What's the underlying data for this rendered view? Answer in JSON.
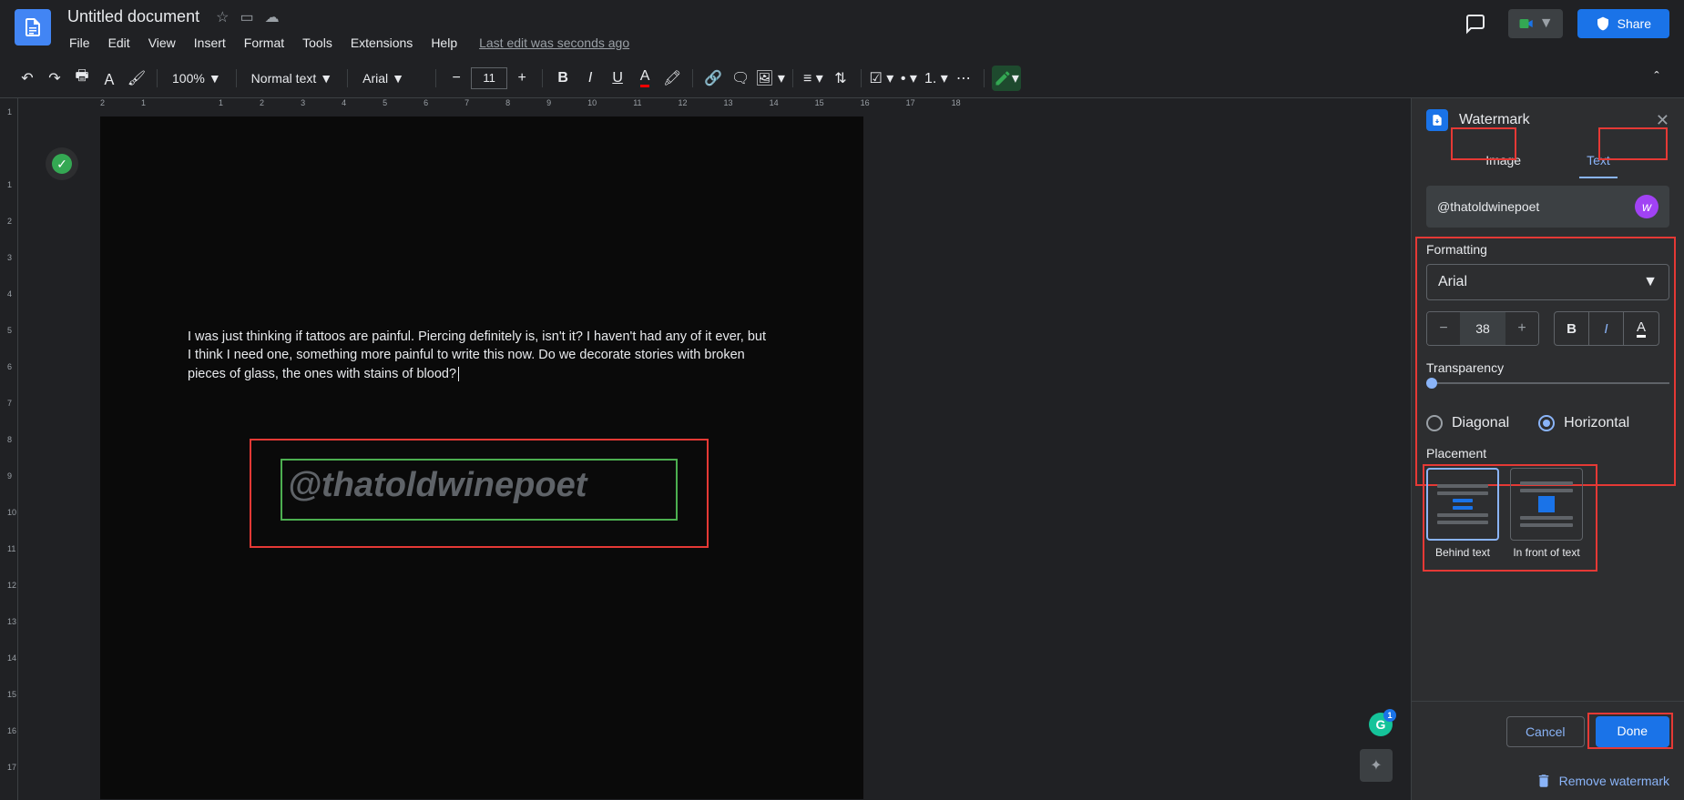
{
  "header": {
    "doc_title": "Untitled document",
    "last_edit": "Last edit was seconds ago",
    "share": "Share"
  },
  "menu": {
    "file": "File",
    "edit": "Edit",
    "view": "View",
    "insert": "Insert",
    "format": "Format",
    "tools": "Tools",
    "extensions": "Extensions",
    "help": "Help"
  },
  "toolbar": {
    "zoom": "100%",
    "style": "Normal text",
    "font": "Arial",
    "font_size": "11"
  },
  "ruler_h": [
    "2",
    "1",
    "",
    "1",
    "2",
    "3",
    "4",
    "5",
    "6",
    "7",
    "8",
    "9",
    "10",
    "11",
    "12",
    "13",
    "14",
    "15",
    "16",
    "17",
    "18"
  ],
  "ruler_v": [
    "1",
    "",
    "1",
    "2",
    "3",
    "4",
    "5",
    "6",
    "7",
    "8",
    "9",
    "10",
    "11",
    "12",
    "13",
    "14",
    "15",
    "16",
    "17"
  ],
  "document": {
    "body_text": "I was just thinking if tattoos are painful. Piercing definitely is, isn't it? I haven't had any of it ever, but I think I need one, something more painful to write this now. Do we decorate stories with broken pieces of glass, the ones with stains of blood?",
    "watermark_text": "@thatoldwinepoet"
  },
  "grammarly_count": "1",
  "side_panel": {
    "title": "Watermark",
    "tabs": {
      "image": "Image",
      "text": "Text"
    },
    "text_value": "@thatoldwinepoet",
    "formatting_label": "Formatting",
    "font_select": "Arial",
    "font_size": "38",
    "transparency_label": "Transparency",
    "orientation": {
      "diagonal": "Diagonal",
      "horizontal": "Horizontal"
    },
    "placement_label": "Placement",
    "placement": {
      "behind": "Behind text",
      "front": "In front of text"
    },
    "cancel": "Cancel",
    "done": "Done",
    "remove": "Remove watermark"
  }
}
